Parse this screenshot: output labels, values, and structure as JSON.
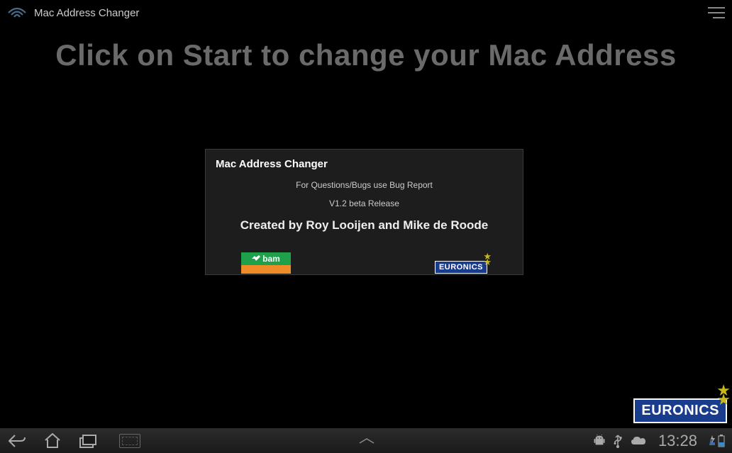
{
  "topBar": {
    "appTitle": "Mac Address Changer"
  },
  "headline": "Click on Start to change your Mac Address",
  "dialog": {
    "title": "Mac Address Changer",
    "line1": "For Questions/Bugs use Bug Report",
    "line2": "V1.2 beta Release",
    "credits": "Created by Roy Looijen and Mike de Roode",
    "logo1Text": "bam",
    "logo2Text": "EURONICS"
  },
  "watermark": {
    "text": "EURONICS"
  },
  "navBar": {
    "clock": "13:28"
  }
}
